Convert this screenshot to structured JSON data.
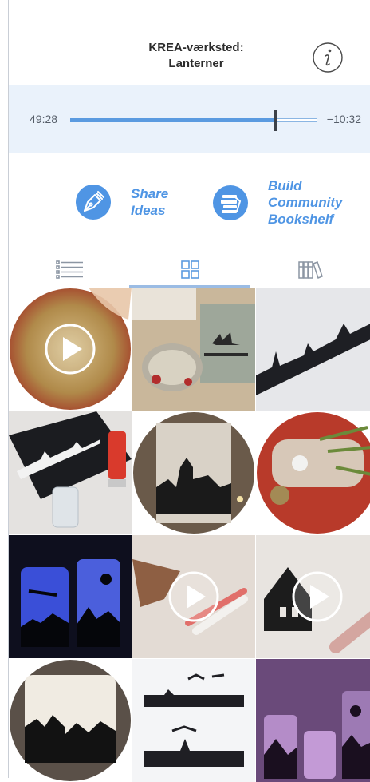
{
  "header": {
    "title_line1": "KREA-værksted:",
    "title_line2": "Lanterner",
    "info_icon": "info-icon"
  },
  "player": {
    "elapsed": "49:28",
    "remaining": "−10:32",
    "progress": 0.83
  },
  "actions": [
    {
      "label": "Share\nIdeas",
      "icon": "pen-nib-icon"
    },
    {
      "label": "Build\nCommunity\nBookshelf",
      "icon": "books-icon"
    }
  ],
  "tabs": [
    {
      "name": "list",
      "icon": "list-icon",
      "active": false
    },
    {
      "name": "grid",
      "icon": "grid-icon",
      "active": true
    },
    {
      "name": "bookshelf",
      "icon": "bookshelf-icon",
      "active": false
    }
  ],
  "colors": {
    "accent": "#4f95e4",
    "progress_bg": "#eaf2fb",
    "active_tab_bar": "#9bbce4"
  },
  "tiles": [
    {
      "shape": "circle",
      "video": true,
      "theme": "glitter-paper"
    },
    {
      "shape": "square",
      "video": false,
      "theme": "tealight-wreath"
    },
    {
      "shape": "square",
      "video": false,
      "theme": "paper-silhouette"
    },
    {
      "shape": "square",
      "video": false,
      "theme": "spray-paint-jar"
    },
    {
      "shape": "circle",
      "video": false,
      "theme": "church-lantern"
    },
    {
      "shape": "circle",
      "video": false,
      "theme": "twine-jar"
    },
    {
      "shape": "square",
      "video": false,
      "theme": "blue-lit-jars"
    },
    {
      "shape": "square",
      "video": true,
      "theme": "drawing-reindeer"
    },
    {
      "shape": "square",
      "video": true,
      "theme": "drawing-house"
    },
    {
      "shape": "circle",
      "video": false,
      "theme": "house-lantern"
    },
    {
      "shape": "square",
      "video": false,
      "theme": "sleigh-strips"
    },
    {
      "shape": "square",
      "video": false,
      "theme": "purple-jars"
    }
  ]
}
